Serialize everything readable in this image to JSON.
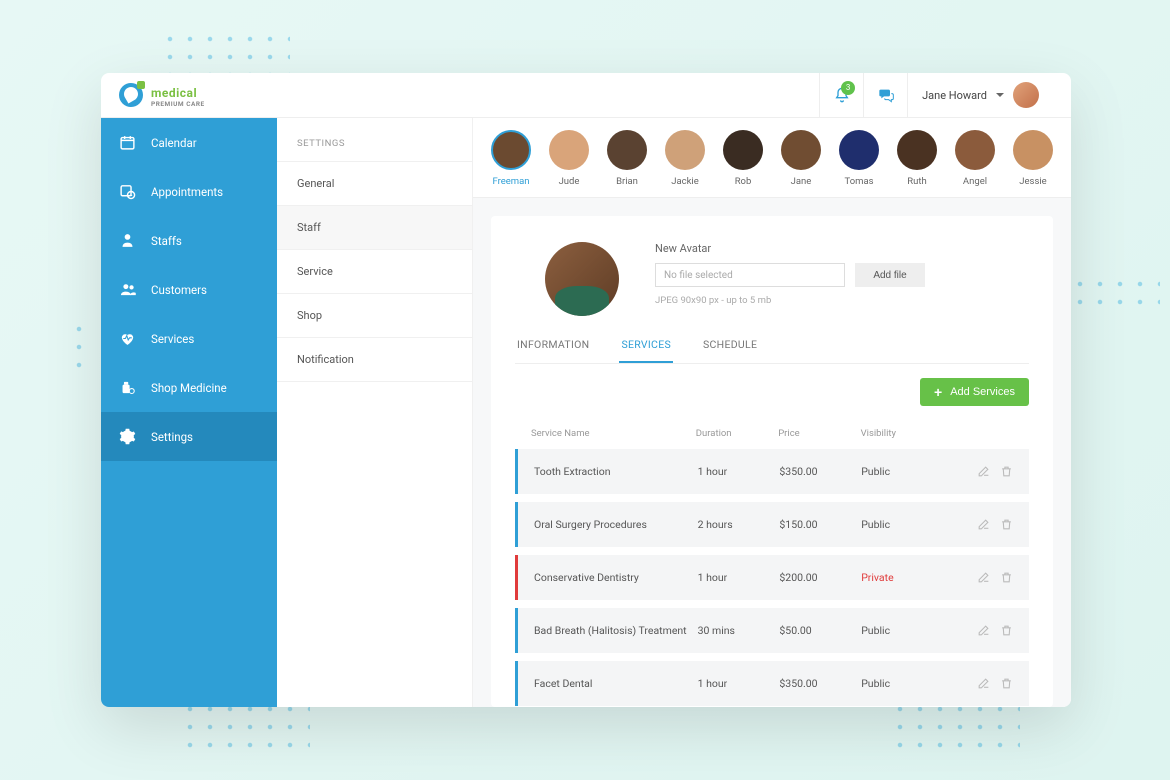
{
  "brand": {
    "name": "medical",
    "sub": "PREMIUM CARE"
  },
  "topbar": {
    "notification_count": "3",
    "user_name": "Jane Howard"
  },
  "sidebar": {
    "items": [
      {
        "label": "Calendar"
      },
      {
        "label": "Appointments"
      },
      {
        "label": "Staffs"
      },
      {
        "label": "Customers"
      },
      {
        "label": "Services"
      },
      {
        "label": "Shop Medicine"
      },
      {
        "label": "Settings"
      }
    ]
  },
  "subnav": {
    "title": "SETTINGS",
    "items": [
      {
        "label": "General"
      },
      {
        "label": "Staff"
      },
      {
        "label": "Service"
      },
      {
        "label": "Shop"
      },
      {
        "label": "Notification"
      }
    ]
  },
  "staff_strip": [
    {
      "name": "Freeman",
      "selected": true
    },
    {
      "name": "Jude"
    },
    {
      "name": "Brian"
    },
    {
      "name": "Jackie"
    },
    {
      "name": "Rob"
    },
    {
      "name": "Jane"
    },
    {
      "name": "Tomas"
    },
    {
      "name": "Ruth"
    },
    {
      "name": "Angel"
    },
    {
      "name": "Jessie"
    }
  ],
  "avatar_form": {
    "label": "New Avatar",
    "placeholder": "No file selected",
    "add_file_label": "Add file",
    "hint": "JPEG 90x90 px - up to 5 mb"
  },
  "tabs": [
    {
      "label": "INFORMATION"
    },
    {
      "label": "SERVICES",
      "active": true
    },
    {
      "label": "SCHEDULE"
    }
  ],
  "add_services_label": "Add Services",
  "table": {
    "headers": {
      "name": "Service Name",
      "duration": "Duration",
      "price": "Price",
      "visibility": "Visibility"
    },
    "rows": [
      {
        "name": "Tooth Extraction",
        "duration": "1 hour",
        "price": "$350.00",
        "visibility": "Public"
      },
      {
        "name": "Oral Surgery Procedures",
        "duration": "2 hours",
        "price": "$150.00",
        "visibility": "Public"
      },
      {
        "name": "Conservative Dentistry",
        "duration": "1 hour",
        "price": "$200.00",
        "visibility": "Private"
      },
      {
        "name": "Bad Breath (Halitosis) Treatment",
        "duration": "30 mins",
        "price": "$50.00",
        "visibility": "Public"
      },
      {
        "name": "Facet Dental",
        "duration": "1 hour",
        "price": "$350.00",
        "visibility": "Public"
      }
    ]
  },
  "staff_colors": [
    "#6b4a30",
    "#d9a47a",
    "#5a4231",
    "#cfa179",
    "#3a2c22",
    "#704d32",
    "#1f2e6d",
    "#4a3222",
    "#8b5b3c",
    "#c89163"
  ]
}
